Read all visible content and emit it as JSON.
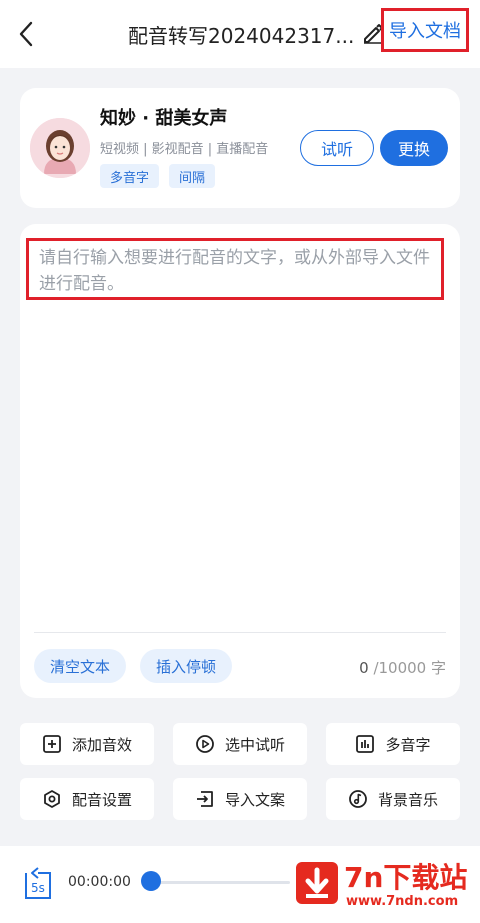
{
  "header": {
    "title": "配音转写2024042317...",
    "import_doc_label": "导入文档"
  },
  "voice": {
    "name": "知妙 · 甜美女声",
    "tags": "短视频 | 影视配音 | 直播配音",
    "chips": [
      "多音字",
      "间隔"
    ],
    "listen_label": "试听",
    "change_label": "更换"
  },
  "editor": {
    "placeholder": "请自行输入想要进行配音的文字，或从外部导入文件进行配音。",
    "clear_label": "清空文本",
    "insert_pause_label": "插入停顿",
    "count_current": "0",
    "count_max": "/10000 字"
  },
  "tools": [
    {
      "label": "添加音效",
      "icon": "plus-square-icon"
    },
    {
      "label": "选中试听",
      "icon": "play-circle-icon"
    },
    {
      "label": "多音字",
      "icon": "bar-chart-icon"
    },
    {
      "label": "配音设置",
      "icon": "hexagon-settings-icon"
    },
    {
      "label": "导入文案",
      "icon": "import-icon"
    },
    {
      "label": "背景音乐",
      "icon": "music-note-icon"
    }
  ],
  "player": {
    "rewind_label": "5s",
    "time": "00:00:00",
    "progress": 0
  },
  "watermark": {
    "title": "7n下载站",
    "url": "www.7ndn.com"
  },
  "colors": {
    "accent": "#1f6fe0",
    "highlight_border": "#e0202a",
    "chip_bg": "#e8f1fd",
    "watermark_red": "#e52a1f"
  }
}
